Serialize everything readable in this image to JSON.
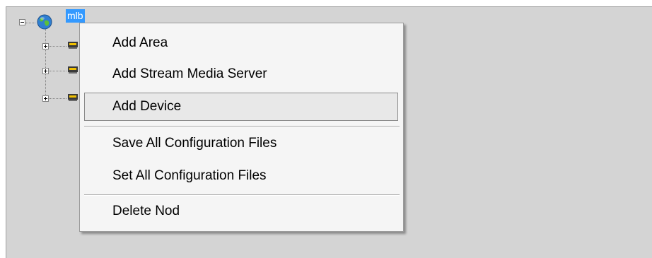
{
  "tree": {
    "root": {
      "label": "mlb",
      "icon": "globe-icon",
      "expanded": true
    },
    "children": [
      {
        "icon": "server-icon",
        "expanded": false
      },
      {
        "icon": "server-icon",
        "expanded": false
      },
      {
        "icon": "server-icon",
        "expanded": false
      }
    ]
  },
  "context_menu": {
    "items": [
      {
        "label": "Add Area"
      },
      {
        "label": "Add Stream Media Server"
      },
      {
        "label": "Add Device",
        "highlighted": true
      },
      {
        "label": "Save All Configuration Files"
      },
      {
        "label": "Set All Configuration Files"
      },
      {
        "label": "Delete Nod"
      }
    ]
  },
  "colors": {
    "panel_bg": "#d4d4d4",
    "selection": "#3399ff",
    "menu_bg": "#f5f5f5"
  }
}
